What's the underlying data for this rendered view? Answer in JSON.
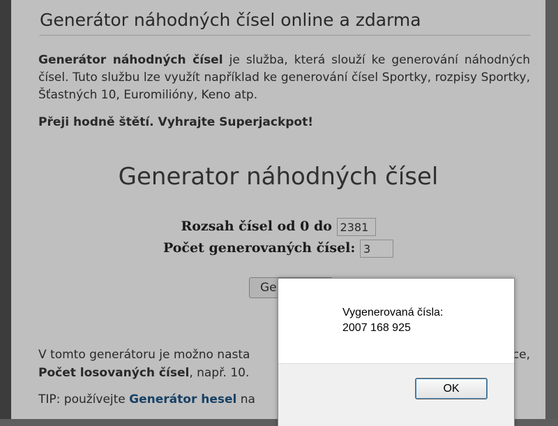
{
  "page": {
    "title": "Generátor náhodných čísel online a zdarma",
    "intro": {
      "bold_lead": "Generátor náhodných čísel",
      "text": " je služba, která slouží ke generování náhodných čísel. Tuto službu lze využít například ke generování čísel Sportky, rozpisy Sportky, Šťastných 10, Euromilióny, Keno atp."
    },
    "wish": "Přeji hodně štětí. Vyhrajte Superjackpot!"
  },
  "generator": {
    "heading": "Generator náhodných čísel",
    "range_label": "Rozsah čísel od 0 do",
    "range_value": "2381",
    "count_label": "Počet generovaných čísel:",
    "count_value": "3",
    "generate_button_label": "Ge"
  },
  "description": {
    "line1": "V tomto generátoru je možno nasta",
    "line1_end": "ce,",
    "bold": "Počet losovaných čísel",
    "line2_rest": ", např. 10."
  },
  "tip": {
    "prefix": "TIP: používejte ",
    "link": "Generátor hesel",
    "suffix": " na"
  },
  "dialog": {
    "line1": "Vygenerovaná čísla:",
    "line2": "2007 168 925",
    "ok_label": "OK"
  },
  "colors": {
    "page_bg": "#e9e9e9",
    "link": "#1d4f7a",
    "dialog_bg": "#ffffff",
    "dialog_footer": "#f0f0f0"
  }
}
